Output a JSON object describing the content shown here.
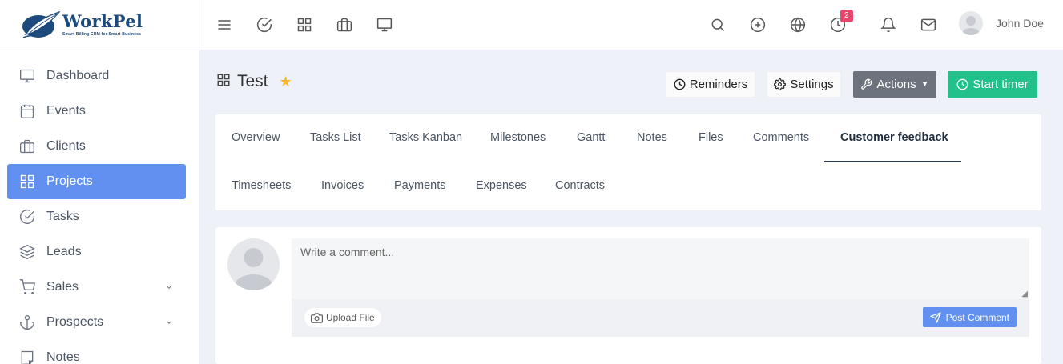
{
  "app": {
    "brand": "WorkPel",
    "tagline": "Smart Billing CRM for Smart Business"
  },
  "sidebar": {
    "items": [
      {
        "label": "Dashboard",
        "icon": "monitor-icon"
      },
      {
        "label": "Events",
        "icon": "calendar-icon"
      },
      {
        "label": "Clients",
        "icon": "briefcase-icon"
      },
      {
        "label": "Projects",
        "icon": "grid-icon",
        "active": true
      },
      {
        "label": "Tasks",
        "icon": "check-circle-icon"
      },
      {
        "label": "Leads",
        "icon": "layers-icon"
      },
      {
        "label": "Sales",
        "icon": "cart-icon",
        "expandable": true
      },
      {
        "label": "Prospects",
        "icon": "anchor-icon",
        "expandable": true
      },
      {
        "label": "Notes",
        "icon": "note-icon"
      }
    ]
  },
  "topbar": {
    "icons": [
      "menu-icon",
      "check-circle-icon",
      "grid-icon",
      "briefcase-icon",
      "monitor-icon",
      "search-icon",
      "plus-circle-icon",
      "globe-icon",
      "clock-icon",
      "bell-icon",
      "mail-icon"
    ],
    "timer_badge": "2",
    "user_name": "John Doe"
  },
  "page": {
    "title": "Test",
    "starred": true
  },
  "actions": {
    "reminders": "Reminders",
    "settings": "Settings",
    "actions": "Actions",
    "start_timer": "Start timer"
  },
  "tabs": {
    "row1": [
      "Overview",
      "Tasks List",
      "Tasks Kanban",
      "Milestones",
      "Gantt",
      "Notes",
      "Files",
      "Comments",
      "Customer feedback"
    ],
    "row2": [
      "Timesheets",
      "Invoices",
      "Payments",
      "Expenses",
      "Contracts"
    ],
    "active": "Customer feedback"
  },
  "comment": {
    "placeholder": "Write a comment...",
    "upload_label": "Upload File",
    "post_label": "Post Comment"
  },
  "colors": {
    "primary": "#6290f0",
    "success": "#22c08a",
    "dark_button": "#6c737c",
    "badge": "#e8456b",
    "star": "#f8b72a",
    "brand": "#1c4a7c"
  }
}
